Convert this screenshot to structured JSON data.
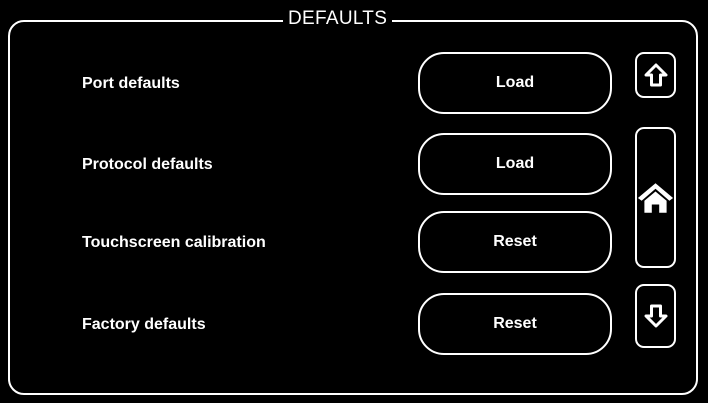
{
  "panel": {
    "title": "DEFAULTS"
  },
  "rows": [
    {
      "label": "Port defaults",
      "button": "Load"
    },
    {
      "label": "Protocol defaults",
      "button": "Load"
    },
    {
      "label": "Touchscreen calibration",
      "button": "Reset"
    },
    {
      "label": "Factory defaults",
      "button": "Reset"
    }
  ],
  "side_buttons": {
    "up_icon": "arrow-up-icon",
    "home_icon": "home-icon",
    "down_icon": "arrow-down-icon"
  },
  "colors": {
    "background": "#000000",
    "foreground": "#ffffff"
  }
}
